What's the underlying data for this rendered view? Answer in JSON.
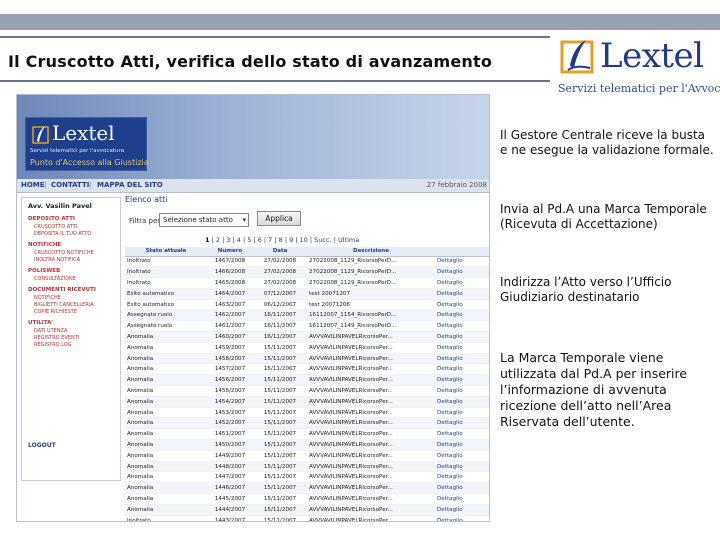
{
  "slide": {
    "title": "Il Cruscotto Atti, verifica dello stato di avanzamento",
    "brand": {
      "name": "Lextel",
      "tagline": "Servizi telematici per l'Avvocatura"
    },
    "paragraphs": [
      "Il Gestore Centrale riceve la busta e ne esegue la validazione formale.",
      "Invia al Pd.A una Marca Temporale (Ricevuta di Accettazione)",
      "Indirizza l’Atto verso l’Ufficio Giudiziario destinatario",
      "La Marca Temporale viene utilizzata dal Pd.A per inserire l’informazione di avvenuta ricezione dell’atto nell’Area Riservata dell’utente."
    ]
  },
  "screenshot": {
    "header": {
      "logo_name": "Lextel",
      "logo_sub": "Servizi telematici per l'avvocatura",
      "portal": "Punto d'Accesso alla Giustizia"
    },
    "nav": {
      "home": "HOME",
      "contatti": "CONTATTI",
      "mappa": "MAPPA DEL SITO",
      "date": "27 febbraio 2008"
    },
    "sidebar": {
      "user": "Avv. Vasilin Pavel",
      "sections": [
        {
          "title": "DEPOSITO ATTI",
          "items": [
            "CRUSCOTTO ATTI",
            "DEPOSITA IL TUO ATTO"
          ]
        },
        {
          "title": "NOTIFICHE",
          "items": [
            "CRUSCOTTO NOTIFICHE",
            "INOLTRA NOTIFICA"
          ]
        },
        {
          "title": "POLISWEB",
          "items": [
            "CONSULTAZIONE"
          ]
        },
        {
          "title": "DOCUMENTI RICEVUTI",
          "items": [
            "NOTIFICHE",
            "BIGLIETTI CANCELLERIA",
            "COPIE RICHIESTE"
          ]
        },
        {
          "title": "UTILITA'",
          "items": [
            "DATI UTENZA",
            "REGISTRO EVENTI",
            "REGISTRO LOG"
          ]
        }
      ],
      "logout": "LOGOUT"
    },
    "main": {
      "section_title": "Elenco atti",
      "filter_label": "Filtra per:",
      "filter_value": "Selezione stato atto",
      "apply_label": "Applica",
      "pager_current": "1",
      "pager_pages": "| 2 | 3 | 4 | 5 | 6 | 7 | 8 | 9 | 10 |",
      "pager_next": "Succ.",
      "pager_last": "Ultima",
      "columns": [
        "Stato attuale",
        "Numero",
        "Data",
        "Descrizione",
        ""
      ],
      "rows": [
        [
          "Inoltrato",
          "1467/2008",
          "27/02/2008",
          "27022008_1129_RicorsoPerD...",
          "Dettaglio"
        ],
        [
          "Inoltrato",
          "1466/2008",
          "27/02/2008",
          "27022008_1129_RicorsoPerD...",
          "Dettaglio"
        ],
        [
          "Inoltrato",
          "1465/2008",
          "27/02/2008",
          "27022008_1129_RicorsoPerD...",
          "Dettaglio"
        ],
        [
          "Esito automatico",
          "1464/2007",
          "07/12/2007",
          "test 20071207",
          "Dettaglio"
        ],
        [
          "Esito automatico",
          "1463/2007",
          "06/12/2007",
          "test 20071206",
          "Dettaglio"
        ],
        [
          "Assegnato ruolo",
          "1462/2007",
          "16/11/2007",
          "16112007_1154_RicorsoPerD...",
          "Dettaglio"
        ],
        [
          "Assegnato ruolo",
          "1461/2007",
          "16/11/2007",
          "16112007_1149_RicorsoPerD...",
          "Dettaglio"
        ],
        [
          "Anomalia",
          "1460/2007",
          "16/11/2007",
          "AVVVAVILINPAVELRicorsoPer...",
          "Dettaglio"
        ],
        [
          "Anomalia",
          "1459/2007",
          "15/11/2007",
          "AVVVAVILINPAVELRicorsoPer...",
          "Dettaglio"
        ],
        [
          "Anomalia",
          "1458/2007",
          "15/11/2007",
          "AVVVAVILINPAVELRicorsoPer...",
          "Dettaglio"
        ],
        [
          "Anomalia",
          "1457/2007",
          "15/11/2007",
          "AVVVAVILINPAVELRicorsoPer...",
          "Dettaglio"
        ],
        [
          "Anomalia",
          "1456/2007",
          "15/11/2007",
          "AVVVAVILINPAVELRicorsoPer...",
          "Dettaglio"
        ],
        [
          "Anomalia",
          "1455/2007",
          "15/11/2007",
          "AVVVAVILINPAVELRicorsoPer...",
          "Dettaglio"
        ],
        [
          "Anomalia",
          "1454/2007",
          "15/11/2007",
          "AVVVAVILINPAVELRicorsoPer...",
          "Dettaglio"
        ],
        [
          "Anomalia",
          "1453/2007",
          "15/11/2007",
          "AVVVAVILINPAVELRicorsoPer...",
          "Dettaglio"
        ],
        [
          "Anomalia",
          "1452/2007",
          "15/11/2007",
          "AVVVAVILINPAVELRicorsoPer...",
          "Dettaglio"
        ],
        [
          "Anomalia",
          "1451/2007",
          "15/11/2007",
          "AVVVAVILINPAVELRicorsoPer...",
          "Dettaglio"
        ],
        [
          "Anomalia",
          "1450/2007",
          "15/11/2007",
          "AVVVAVILINPAVELRicorsoPer...",
          "Dettaglio"
        ],
        [
          "Anomalia",
          "1449/2007",
          "15/11/2007",
          "AVVVAVILINPAVELRicorsoPer...",
          "Dettaglio"
        ],
        [
          "Anomalia",
          "1448/2007",
          "15/11/2007",
          "AVVVAVILINPAVELRicorsoPer...",
          "Dettaglio"
        ],
        [
          "Anomalia",
          "1447/2007",
          "15/11/2007",
          "AVVVAVILINPAVELRicorsoPer...",
          "Dettaglio"
        ],
        [
          "Anomalia",
          "1446/2007",
          "15/11/2007",
          "AVVVAVILINPAVELRicorsoPer...",
          "Dettaglio"
        ],
        [
          "Anomalia",
          "1445/2007",
          "15/11/2007",
          "AVVVAVILINPAVELRicorsoPer...",
          "Dettaglio"
        ],
        [
          "Anomalia",
          "1444/2007",
          "15/11/2007",
          "AVVVAVILINPAVELRicorsoPer...",
          "Dettaglio"
        ],
        [
          "Inoltrato",
          "1443/2007",
          "15/11/2007",
          "AVVVAVILINPAVELRicorsoPer...",
          "Dettaglio"
        ]
      ]
    }
  }
}
